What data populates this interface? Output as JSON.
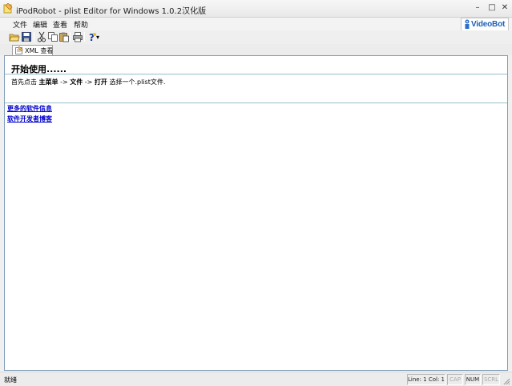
{
  "window": {
    "title": "iPodRobot - plist Editor for Windows 1.0.2汉化版",
    "controls": {
      "minimize": "–",
      "maximize": "□",
      "close": "✕"
    }
  },
  "menu": {
    "items": [
      {
        "label": "文件"
      },
      {
        "label": "编辑"
      },
      {
        "label": "查看"
      },
      {
        "label": "帮助"
      }
    ]
  },
  "logo": {
    "text": "VideoBot",
    "brand_color": "#1f5fb5"
  },
  "toolbar": {
    "buttons": [
      {
        "icon": "open-folder-icon"
      },
      {
        "icon": "save-icon"
      },
      {
        "icon": "cut-icon"
      },
      {
        "icon": "copy-icon"
      },
      {
        "icon": "paste-icon"
      },
      {
        "icon": "print-icon"
      },
      {
        "icon": "help-icon"
      }
    ],
    "dropdown_arrow": "▾"
  },
  "tabs": [
    {
      "label": "XML 查看",
      "icon": "xml-view-icon",
      "active": true
    }
  ],
  "content": {
    "heading": "开始使用......",
    "instruction": {
      "prefix": "首先点击",
      "step1": "主菜单",
      "arrow1": "->",
      "step2": "文件",
      "arrow2": "->",
      "step3": "打开",
      "suffix": "选择一个.plist文件."
    },
    "links": [
      {
        "label": "更多的软件信息"
      },
      {
        "label": "软件开发者博客"
      }
    ]
  },
  "statusbar": {
    "text": "就绪",
    "position": "Line: 1 Col: 1",
    "indicators": [
      {
        "label": "CAP",
        "active": false
      },
      {
        "label": "NUM",
        "active": true
      },
      {
        "label": "SCRL",
        "active": false
      }
    ]
  },
  "colors": {
    "link": "#0000cc",
    "divider": "#9ac0cd"
  }
}
